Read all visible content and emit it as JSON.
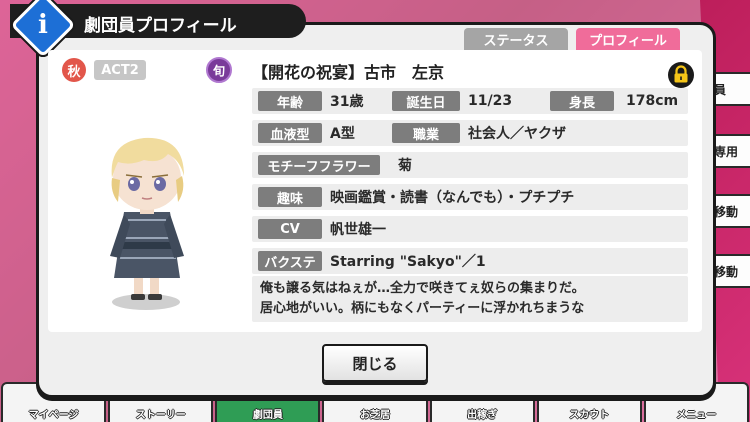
{
  "dialog": {
    "title": "劇団員プロフィール",
    "info_glyph": "i",
    "tabs": {
      "status": "ステータス",
      "profile": "プロフィール"
    }
  },
  "character": {
    "season_badge": "秋",
    "troupe_badge": "ACT2",
    "rarity_badge": "旬",
    "name": "【開花の祝宴】古市　左京"
  },
  "profile": {
    "age_label": "年齢",
    "age": "31歳",
    "birthday_label": "誕生日",
    "birthday": "11/23",
    "height_label": "身長",
    "height": "178cm",
    "blood_label": "血液型",
    "blood": "A型",
    "job_label": "職業",
    "job": "社会人／ヤクザ",
    "flower_label": "モチーフフラワー",
    "flower": "菊",
    "hobby_label": "趣味",
    "hobby": "映画鑑賞・読書（なんでも）・プチプチ",
    "cv_label": "CV",
    "cv": "帆世雄一",
    "bakusute_label": "バクステ",
    "bakusute": "Starring \"Sakyo\"／1",
    "quote_line1": "俺も譲る気はねぇが…全力で咲きてぇ奴らの集まりだ。",
    "quote_line2": "居心地がいい。柄にもなくパーティーに浮かれちまうな"
  },
  "close_label": "閉じる",
  "side_tabs": [
    "員",
    "専用",
    "移動",
    "移動"
  ],
  "bottom_nav": [
    "マイページ",
    "ストーリー",
    "劇団員",
    "お芝居",
    "出稼ぎ",
    "スカウト",
    "メニュー"
  ],
  "colors": {
    "accent_pink": "#f06c9a",
    "label_gray": "#7d7d7d",
    "info_blue": "#1d6fd6"
  }
}
